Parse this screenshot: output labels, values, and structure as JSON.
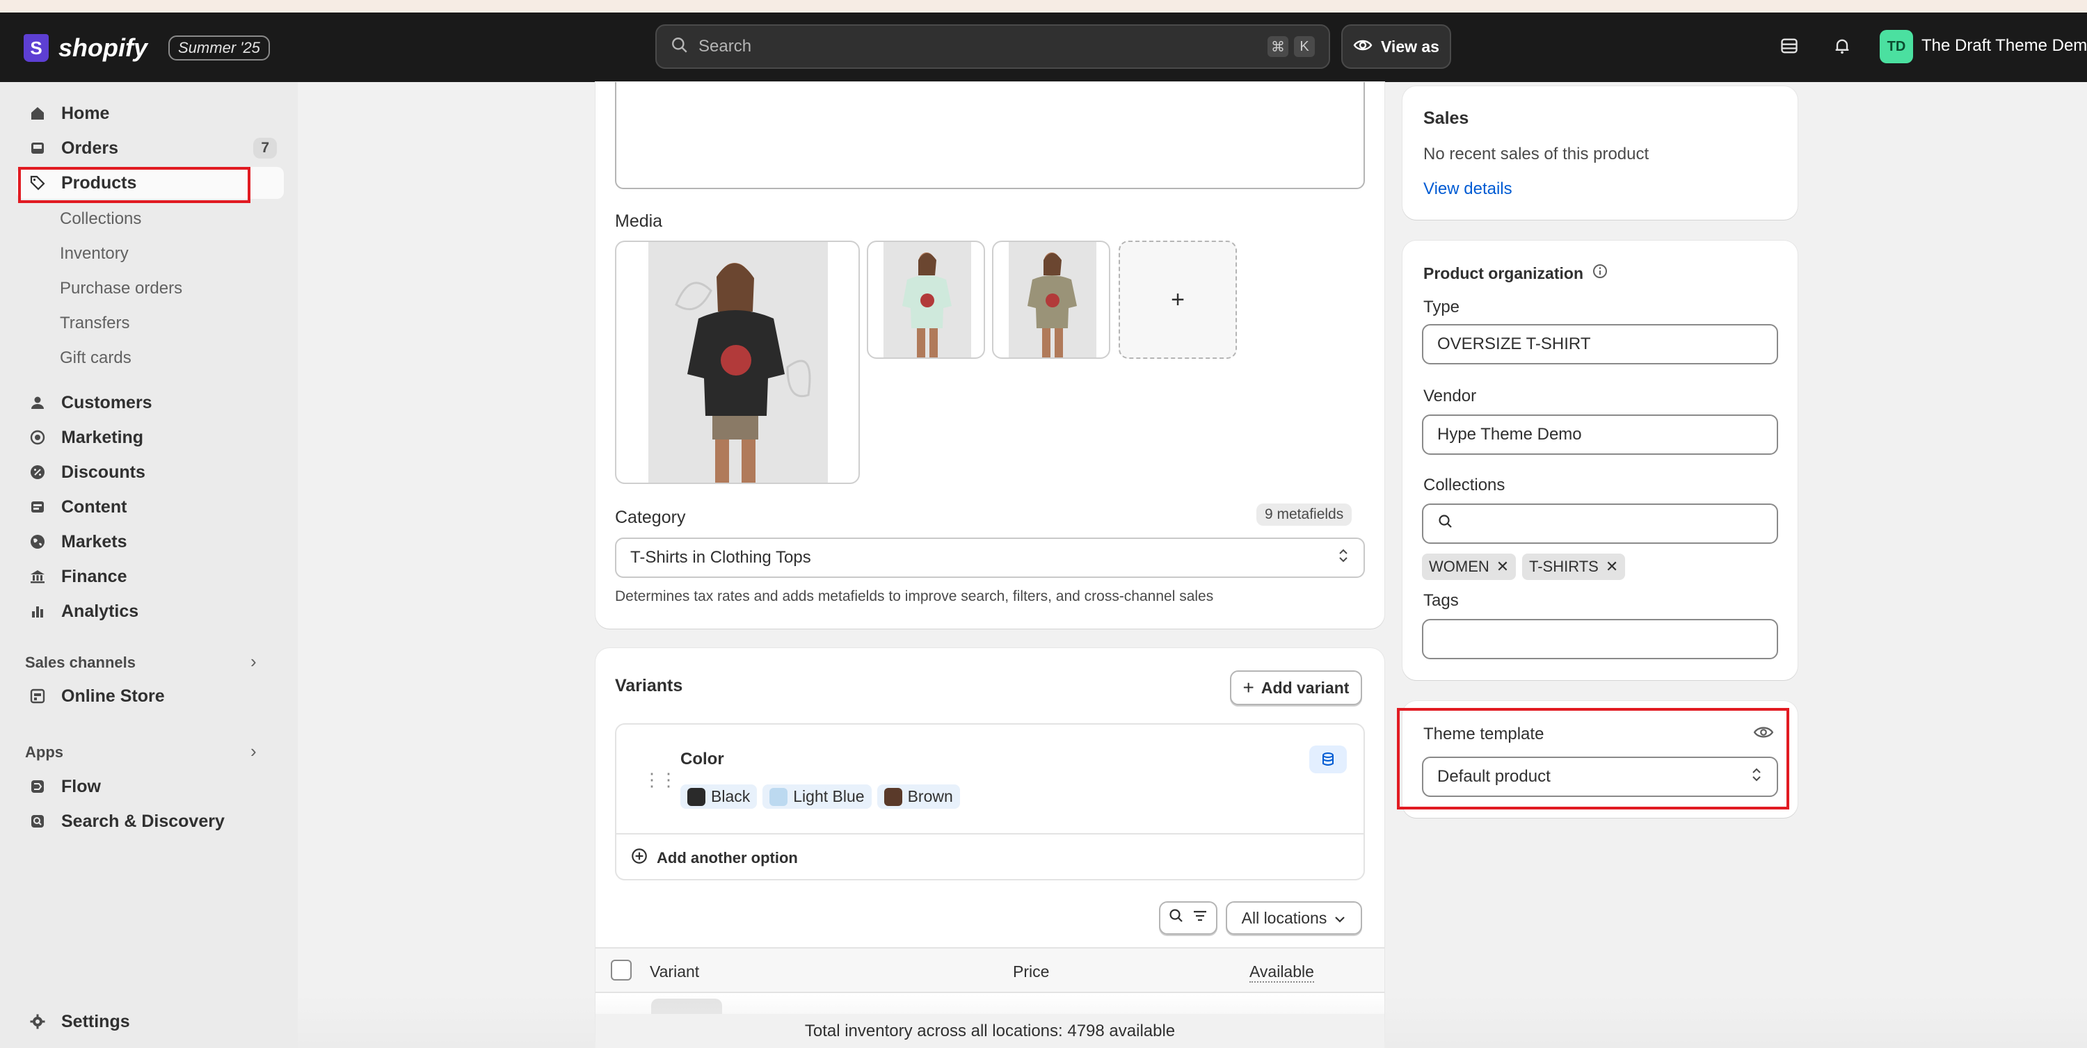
{
  "topbar": {
    "logo_text": "shopify",
    "edition": "Summer '25",
    "search_placeholder": "Search",
    "shortcut_keys": [
      "⌘",
      "K"
    ],
    "view_as": "View as",
    "avatar_initials": "TD",
    "store_name": "The Draft Theme Demo"
  },
  "sidebar": {
    "home": "Home",
    "orders": "Orders",
    "orders_count": "7",
    "products": "Products",
    "product_subitems": [
      "Collections",
      "Inventory",
      "Purchase orders",
      "Transfers",
      "Gift cards"
    ],
    "customers": "Customers",
    "marketing": "Marketing",
    "discounts": "Discounts",
    "content": "Content",
    "markets": "Markets",
    "finance": "Finance",
    "analytics": "Analytics",
    "sales_channels_label": "Sales channels",
    "online_store": "Online Store",
    "apps_label": "Apps",
    "flow": "Flow",
    "search_discovery": "Search & Discovery",
    "settings": "Settings"
  },
  "main": {
    "media_label": "Media",
    "add_media": "+",
    "category_label": "Category",
    "metafields_badge": "9 metafields",
    "category_value_strong": "T-Shirts",
    "category_value_rest": " in Clothing Tops",
    "category_help": "Determines tax rates and adds metafields to improve search, filters, and cross-channel sales",
    "variants_title": "Variants",
    "add_variant": "Add variant",
    "option_name": "Color",
    "option_values": [
      {
        "label": "Black",
        "color": "#2a2a2a"
      },
      {
        "label": "Light Blue",
        "color": "#bcd9f0"
      },
      {
        "label": "Brown",
        "color": "#5a3a2a"
      }
    ],
    "add_another_option": "Add another option",
    "all_locations": "All locations",
    "table_headers": {
      "variant": "Variant",
      "price": "Price",
      "available": "Available"
    },
    "total_inventory": "Total inventory across all locations: 4798 available"
  },
  "right": {
    "sales_title": "Sales",
    "sales_text": "No recent sales of this product",
    "view_details": "View details",
    "org_title": "Product organization",
    "type_label": "Type",
    "type_value": "OVERSIZE T-SHIRT",
    "vendor_label": "Vendor",
    "vendor_value": "Hype Theme Demo",
    "collections_label": "Collections",
    "collection_tags": [
      "WOMEN",
      "T-SHIRTS"
    ],
    "tags_label": "Tags",
    "theme_template_label": "Theme template",
    "theme_template_value": "Default product"
  },
  "colors": {
    "accent_link": "#005bd3",
    "highlight": "#e11b22",
    "topbar": "#1a1a1a"
  }
}
